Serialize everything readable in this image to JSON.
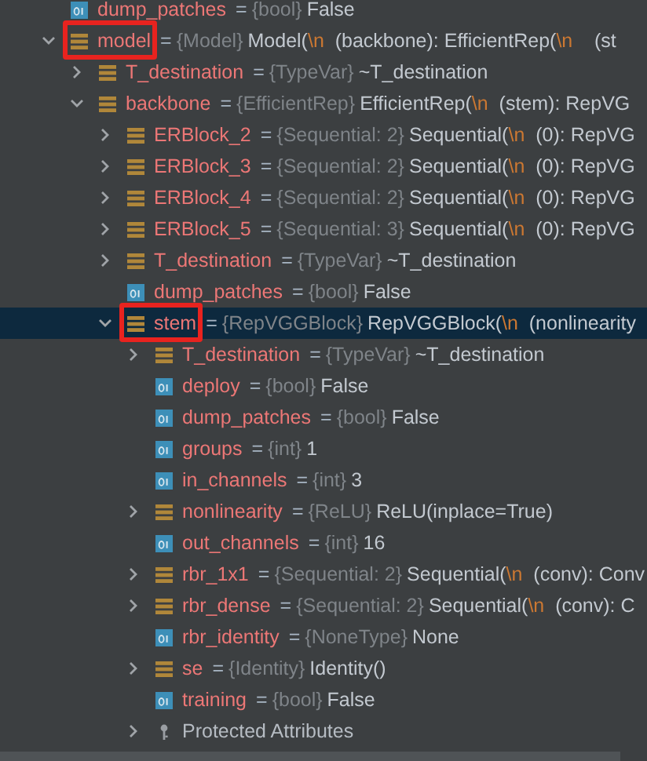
{
  "tree": [
    {
      "kind": "field",
      "name": "dump_patches",
      "eq": "=",
      "type": "{bool}",
      "value": [
        {
          "kind": "plain",
          "text": "False"
        }
      ],
      "selected": false,
      "highlighted": false
    },
    {
      "kind": "object",
      "name": "model",
      "eq": "=",
      "type": "{Model}",
      "value": [
        {
          "kind": "plain",
          "text": "Model("
        },
        {
          "kind": "escape",
          "text": "\\n"
        },
        {
          "kind": "plain",
          "text": "  (backbone): EfficientRep("
        },
        {
          "kind": "escape",
          "text": "\\n"
        },
        {
          "kind": "plain",
          "text": "    (st"
        }
      ],
      "selected": false,
      "highlighted": true,
      "expanded": true,
      "children": [
        {
          "kind": "object",
          "name": "T_destination",
          "eq": "=",
          "type": "{TypeVar}",
          "value": [
            {
              "kind": "plain",
              "text": "~T_destination"
            }
          ],
          "selected": false,
          "highlighted": false,
          "expanded": false
        },
        {
          "kind": "object",
          "name": "backbone",
          "eq": "=",
          "type": "{EfficientRep}",
          "value": [
            {
              "kind": "plain",
              "text": "EfficientRep("
            },
            {
              "kind": "escape",
              "text": "\\n"
            },
            {
              "kind": "plain",
              "text": "  (stem): RepVG"
            }
          ],
          "selected": false,
          "highlighted": false,
          "expanded": true,
          "children": [
            {
              "kind": "object",
              "name": "ERBlock_2",
              "eq": "=",
              "type": "{Sequential: 2}",
              "value": [
                {
                  "kind": "plain",
                  "text": "Sequential("
                },
                {
                  "kind": "escape",
                  "text": "\\n"
                },
                {
                  "kind": "plain",
                  "text": "  (0): RepVG"
                }
              ],
              "selected": false,
              "highlighted": false,
              "expanded": false
            },
            {
              "kind": "object",
              "name": "ERBlock_3",
              "eq": "=",
              "type": "{Sequential: 2}",
              "value": [
                {
                  "kind": "plain",
                  "text": "Sequential("
                },
                {
                  "kind": "escape",
                  "text": "\\n"
                },
                {
                  "kind": "plain",
                  "text": "  (0): RepVG"
                }
              ],
              "selected": false,
              "highlighted": false,
              "expanded": false
            },
            {
              "kind": "object",
              "name": "ERBlock_4",
              "eq": "=",
              "type": "{Sequential: 2}",
              "value": [
                {
                  "kind": "plain",
                  "text": "Sequential("
                },
                {
                  "kind": "escape",
                  "text": "\\n"
                },
                {
                  "kind": "plain",
                  "text": "  (0): RepVG"
                }
              ],
              "selected": false,
              "highlighted": false,
              "expanded": false
            },
            {
              "kind": "object",
              "name": "ERBlock_5",
              "eq": "=",
              "type": "{Sequential: 3}",
              "value": [
                {
                  "kind": "plain",
                  "text": "Sequential("
                },
                {
                  "kind": "escape",
                  "text": "\\n"
                },
                {
                  "kind": "plain",
                  "text": "  (0): RepVG"
                }
              ],
              "selected": false,
              "highlighted": false,
              "expanded": false
            },
            {
              "kind": "object",
              "name": "T_destination",
              "eq": "=",
              "type": "{TypeVar}",
              "value": [
                {
                  "kind": "plain",
                  "text": "~T_destination"
                }
              ],
              "selected": false,
              "highlighted": false,
              "expanded": false
            },
            {
              "kind": "field",
              "name": "dump_patches",
              "eq": "=",
              "type": "{bool}",
              "value": [
                {
                  "kind": "plain",
                  "text": "False"
                }
              ],
              "selected": false,
              "highlighted": false
            },
            {
              "kind": "object",
              "name": "stem",
              "eq": "=",
              "type": "{RepVGGBlock}",
              "value": [
                {
                  "kind": "plain",
                  "text": "RepVGGBlock("
                },
                {
                  "kind": "escape",
                  "text": "\\n"
                },
                {
                  "kind": "plain",
                  "text": "  (nonlinearity"
                }
              ],
              "selected": true,
              "highlighted": true,
              "expanded": true,
              "children": [
                {
                  "kind": "object",
                  "name": "T_destination",
                  "eq": "=",
                  "type": "{TypeVar}",
                  "value": [
                    {
                      "kind": "plain",
                      "text": "~T_destination"
                    }
                  ],
                  "selected": false,
                  "highlighted": false,
                  "expanded": false
                },
                {
                  "kind": "field",
                  "name": "deploy",
                  "eq": "=",
                  "type": "{bool}",
                  "value": [
                    {
                      "kind": "plain",
                      "text": "False"
                    }
                  ],
                  "selected": false,
                  "highlighted": false
                },
                {
                  "kind": "field",
                  "name": "dump_patches",
                  "eq": "=",
                  "type": "{bool}",
                  "value": [
                    {
                      "kind": "plain",
                      "text": "False"
                    }
                  ],
                  "selected": false,
                  "highlighted": false
                },
                {
                  "kind": "field",
                  "name": "groups",
                  "eq": "=",
                  "type": "{int}",
                  "value": [
                    {
                      "kind": "plain",
                      "text": "1"
                    }
                  ],
                  "selected": false,
                  "highlighted": false
                },
                {
                  "kind": "field",
                  "name": "in_channels",
                  "eq": "=",
                  "type": "{int}",
                  "value": [
                    {
                      "kind": "plain",
                      "text": "3"
                    }
                  ],
                  "selected": false,
                  "highlighted": false
                },
                {
                  "kind": "object",
                  "name": "nonlinearity",
                  "eq": "=",
                  "type": "{ReLU}",
                  "value": [
                    {
                      "kind": "plain",
                      "text": "ReLU(inplace=True)"
                    }
                  ],
                  "selected": false,
                  "highlighted": false,
                  "expanded": false
                },
                {
                  "kind": "field",
                  "name": "out_channels",
                  "eq": "=",
                  "type": "{int}",
                  "value": [
                    {
                      "kind": "plain",
                      "text": "16"
                    }
                  ],
                  "selected": false,
                  "highlighted": false
                },
                {
                  "kind": "object",
                  "name": "rbr_1x1",
                  "eq": "=",
                  "type": "{Sequential: 2}",
                  "value": [
                    {
                      "kind": "plain",
                      "text": "Sequential("
                    },
                    {
                      "kind": "escape",
                      "text": "\\n"
                    },
                    {
                      "kind": "plain",
                      "text": "  (conv): Conv"
                    }
                  ],
                  "selected": false,
                  "highlighted": false,
                  "expanded": false
                },
                {
                  "kind": "object",
                  "name": "rbr_dense",
                  "eq": "=",
                  "type": "{Sequential: 2}",
                  "value": [
                    {
                      "kind": "plain",
                      "text": "Sequential("
                    },
                    {
                      "kind": "escape",
                      "text": "\\n"
                    },
                    {
                      "kind": "plain",
                      "text": "  (conv): C"
                    }
                  ],
                  "selected": false,
                  "highlighted": false,
                  "expanded": false
                },
                {
                  "kind": "field",
                  "name": "rbr_identity",
                  "eq": "=",
                  "type": "{NoneType}",
                  "value": [
                    {
                      "kind": "plain",
                      "text": "None"
                    }
                  ],
                  "selected": false,
                  "highlighted": false
                },
                {
                  "kind": "object",
                  "name": "se",
                  "eq": "=",
                  "type": "{Identity}",
                  "value": [
                    {
                      "kind": "plain",
                      "text": "Identity()"
                    }
                  ],
                  "selected": false,
                  "highlighted": false,
                  "expanded": false
                },
                {
                  "kind": "field",
                  "name": "training",
                  "eq": "=",
                  "type": "{bool}",
                  "value": [
                    {
                      "kind": "plain",
                      "text": "False"
                    }
                  ],
                  "selected": false,
                  "highlighted": false
                },
                {
                  "kind": "protected",
                  "name": "Protected Attributes",
                  "selected": false,
                  "highlighted": false,
                  "expanded": false
                }
              ]
            }
          ]
        }
      ]
    }
  ]
}
